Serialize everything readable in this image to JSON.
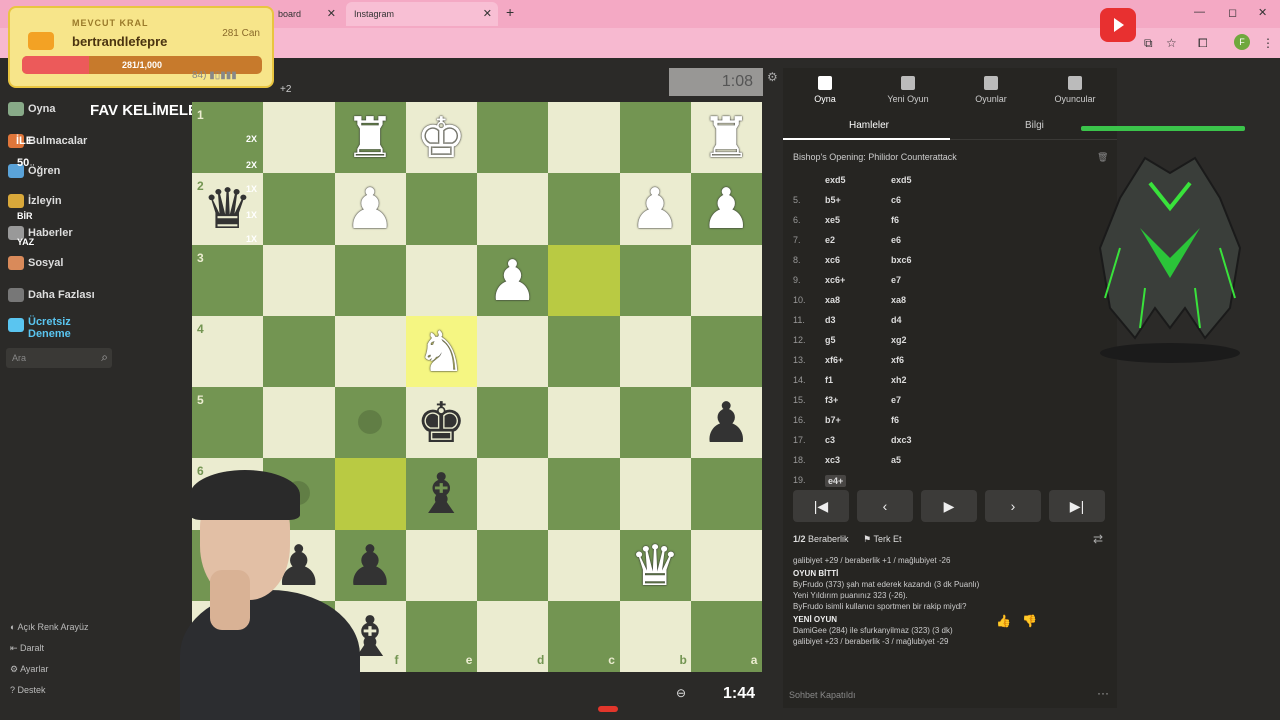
{
  "browser": {
    "tabs": [
      {
        "label": "board"
      },
      {
        "label": "Instagram"
      }
    ],
    "profile_letter": "F"
  },
  "king_box": {
    "label": "MEVCUT KRAL",
    "name": "bertrandlefepre",
    "can": "281 Can",
    "progress_text": "281/1,000",
    "progress": 0.281
  },
  "sidebar": {
    "items": [
      "Oyna",
      "Bulmacalar",
      "Öğren",
      "İzleyin",
      "Haberler",
      "Sosyal",
      "Daha Fazlası",
      "Ücretsiz Deneme"
    ],
    "search_placeholder": "Ara",
    "bottom": [
      "Açık Renk Arayüz",
      "Daralt",
      "Ayarlar",
      "Destek"
    ]
  },
  "overlays": {
    "fav": "FAV KELİMELER",
    "ile": "İLE",
    "n50": "50",
    "bir": "BİR",
    "yaz": "YAZ"
  },
  "board": {
    "top_player_extra": "+2",
    "top_clock": "1:08",
    "bottom_clock": "1:44",
    "rank_labels": [
      "1",
      "2",
      "3",
      "4",
      "5",
      "6"
    ],
    "file_labels": [
      "f",
      "e",
      "d",
      "c",
      "b",
      "a"
    ],
    "premove_marks": [
      "2X",
      "2X",
      "1X",
      "1X",
      "1X"
    ]
  },
  "panel": {
    "tabs": [
      "Oyna",
      "Yeni Oyun",
      "Oyunlar",
      "Oyuncular"
    ],
    "subtabs": [
      "Hamleler",
      "Bilgi"
    ],
    "opening": "Bishop's Opening: Philidor Counterattack",
    "moves": [
      {
        "n": "",
        "w": "exd5",
        "b": "exd5"
      },
      {
        "n": "5.",
        "w": "b5+",
        "b": "c6"
      },
      {
        "n": "6.",
        "w": "xe5",
        "b": "f6"
      },
      {
        "n": "7.",
        "w": "e2",
        "b": "e6"
      },
      {
        "n": "8.",
        "w": "xc6",
        "b": "bxc6"
      },
      {
        "n": "9.",
        "w": "xc6+",
        "b": "e7"
      },
      {
        "n": "10.",
        "w": "xa8",
        "b": "xa8"
      },
      {
        "n": "11.",
        "w": "d3",
        "b": "d4"
      },
      {
        "n": "12.",
        "w": "g5",
        "b": "xg2"
      },
      {
        "n": "13.",
        "w": "xf6+",
        "b": "xf6"
      },
      {
        "n": "14.",
        "w": "f1",
        "b": "xh2"
      },
      {
        "n": "15.",
        "w": "f3+",
        "b": "e7"
      },
      {
        "n": "16.",
        "w": "b7+",
        "b": "f6"
      },
      {
        "n": "17.",
        "w": "c3",
        "b": "dxc3"
      },
      {
        "n": "18.",
        "w": "xc3",
        "b": "a5"
      },
      {
        "n": "19.",
        "w": "e4+",
        "b": ""
      }
    ],
    "actions": {
      "draw": "Beraberlik",
      "resign": "Terk Et",
      "half": "1/2"
    },
    "log": [
      {
        "type": "t",
        "text": "galibiyet +29 / beraberlik +1 / mağlubiyet -26"
      },
      {
        "type": "h",
        "text": "OYUN BİTTİ"
      },
      {
        "type": "t",
        "text": "ByFrudo (373) şah mat ederek kazandı (3 dk Puanlı)"
      },
      {
        "type": "t",
        "text": "Yeni Yıldırım puanınız 323 (-26)."
      },
      {
        "type": "t",
        "text": "ByFrudo isimli kullanıcı sportmen bir rakip miydi?"
      },
      {
        "type": "h",
        "text": "YENİ OYUN"
      },
      {
        "type": "t",
        "text": "DamiGee (284) ile sfurkanyilmaz (323) (3 dk)"
      },
      {
        "type": "t",
        "text": "galibiyet +23 / beraberlik -3 / mağlubiyet -29"
      }
    ],
    "chat_off": "Sohbet Kapatıldı"
  }
}
